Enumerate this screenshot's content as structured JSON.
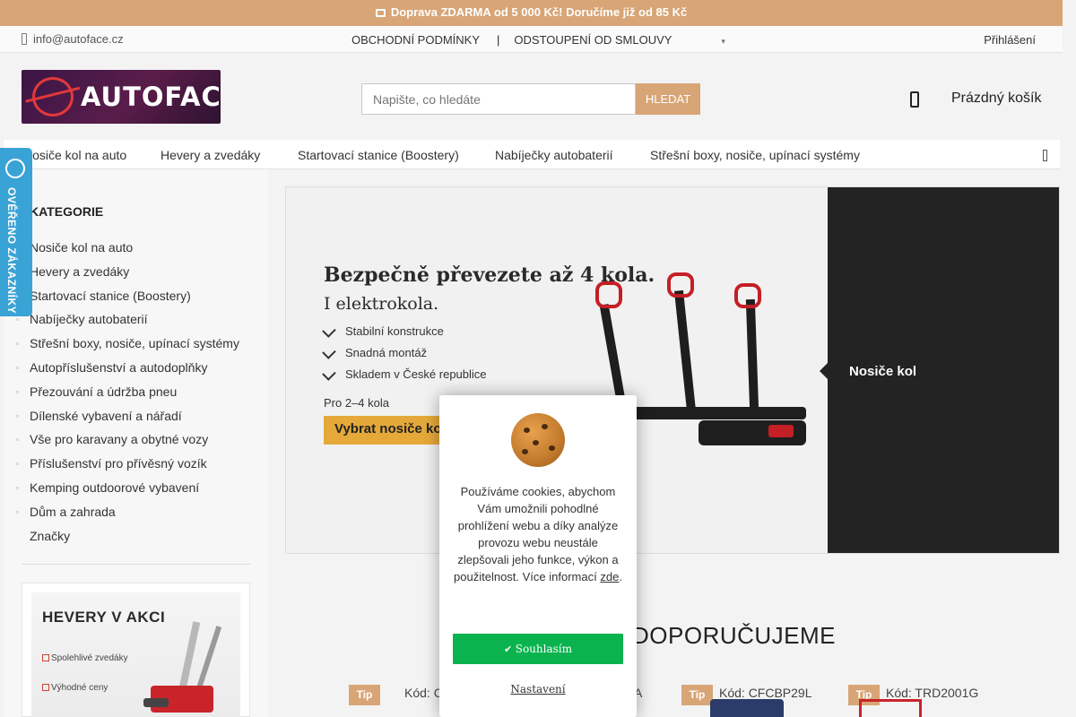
{
  "promo": {
    "text": "Doprava ZDARMA od 5 000 Kč! Doručíme již od 85 Kč"
  },
  "util": {
    "email": "info@autoface.cz",
    "links": [
      "OBCHODNÍ PODMÍNKY",
      "ODSTOUPENÍ OD SMLOUVY"
    ],
    "login": "Přihlášení"
  },
  "header": {
    "logo_text": "AUTOFACE",
    "search_placeholder": "Napište, co hledáte",
    "search_button": "HLEDAT",
    "cart": "Prázdný košík"
  },
  "nav": {
    "items": [
      "Nosiče kol na auto",
      "Hevery a zvedáky",
      "Startovací stanice (Boostery)",
      "Nabíječky autobaterií",
      "Střešní boxy, nosiče, upínací systémy"
    ]
  },
  "badge": {
    "text": "OVĚŘENO ZÁKAZNÍKY"
  },
  "sidebar": {
    "title": "KATEGORIE",
    "items": [
      "Nosiče kol na auto",
      "Hevery a zvedáky",
      "Startovací stanice (Boostery)",
      "Nabíječky autobaterií",
      "Střešní boxy, nosiče, upínací systémy",
      "Autopříslušenství a autodoplňky",
      "Přezouvání a údržba pneu",
      "Dílenské vybavení a nářadí",
      "Vše pro karavany a obytné vozy",
      "Příslušenství pro přívěsný vozík",
      "Kemping outdoorové vybavení",
      "Dům a zahrada",
      "Značky"
    ],
    "promo": {
      "title": "HEVERY V AKCI",
      "line1": "Spolehlivé zvedáky",
      "line2": "Výhodné ceny"
    }
  },
  "hero": {
    "headline1": "Bezpečně převezete až 4 kola.",
    "headline2": "I elektrokola.",
    "bullets": [
      "Stabilní konstrukce",
      "Snadná montáž",
      "Skladem v České republice"
    ],
    "sub": "Pro 2–4 kola",
    "cta": "Vybrat nosiče kol",
    "tab_label": "Nosiče kol",
    "accent_red": "#c41f25",
    "cta_color": "#e5a93a"
  },
  "recommend": {
    "title": "DOPORUČUJEME",
    "tip": "Tip",
    "products": [
      {
        "code": "Kód: C...",
        "extra": "A"
      },
      {
        "code": "Kód: CFCBP29L"
      },
      {
        "code": "Kód: TRD2001G"
      }
    ]
  },
  "cookie": {
    "text": "Používáme cookies, abychom Vám umožnili pohodlné prohlížení webu a díky analýze provozu webu neustále zlepšovali jeho funkce, výkon a použitelnost. Více informací",
    "link": "zde",
    "accept": "Souhlasím",
    "settings": "Nastavení",
    "accept_color": "#0ab34e"
  },
  "colors": {
    "accent": "#d8a576",
    "badge": "#3aa3d6"
  }
}
